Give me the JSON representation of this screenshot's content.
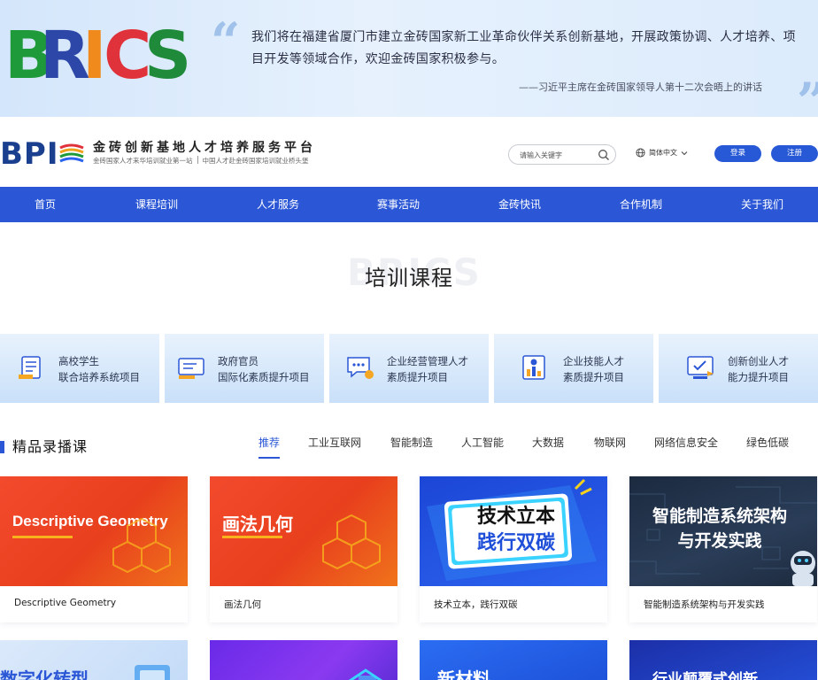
{
  "banner": {
    "logo_letters": [
      "B",
      "R",
      "I",
      "C",
      "S"
    ],
    "quote": "我们将在福建省厦门市建立金砖国家新工业革命伙伴关系创新基地，开展政策协调、人才培养、项目开发等领域合作，欢迎金砖国家积极参与。",
    "source": "——习近平主席在金砖国家领导人第十二次会晤上的讲话"
  },
  "header": {
    "logo_text": "BPI",
    "site_title": "金砖创新基地人才培养服务平台",
    "site_sub_left": "金砖国家人才来华培训就业第一站",
    "site_sub_right": "中国人才赴金砖国家培训就业桥头堡",
    "search_placeholder": "请输入关键字",
    "language": "简体中文",
    "login": "登录",
    "register": "注册"
  },
  "nav": {
    "items": [
      "首页",
      "课程培训",
      "人才服务",
      "赛事活动",
      "金砖快讯",
      "合作机制",
      "关于我们"
    ]
  },
  "training": {
    "watermark": "BRICS",
    "title": "培训课程",
    "categories": [
      {
        "line1": "高校学生",
        "line2": "联合培养系统项目",
        "icon": "student-icon"
      },
      {
        "line1": "政府官员",
        "line2": "国际化素质提升项目",
        "icon": "official-icon"
      },
      {
        "line1": "企业经营管理人才",
        "line2": "素质提升项目",
        "icon": "manager-icon"
      },
      {
        "line1": "企业技能人才",
        "line2": "素质提升项目",
        "icon": "skills-icon"
      },
      {
        "line1": "创新创业人才",
        "line2": "能力提升项目",
        "icon": "innovation-icon"
      }
    ]
  },
  "courses": {
    "title": "精品录播课",
    "tabs": [
      "推荐",
      "工业互联网",
      "智能制造",
      "人工智能",
      "大数据",
      "物联网",
      "网络信息安全",
      "绿色低碳"
    ],
    "active_tab": "推荐",
    "items": [
      {
        "thumb_text": "Descriptive Geometry",
        "label": "Descriptive Geometry"
      },
      {
        "thumb_text": "画法几何",
        "label": "画法几何"
      },
      {
        "thumb_line1": "技术立本",
        "thumb_line2": "践行双碳",
        "label": "技术立本，践行双碳"
      },
      {
        "thumb_line1": "智能制造系统架构",
        "thumb_line2": "与开发实践",
        "label": "智能制造系统架构与开发实践"
      }
    ],
    "row2": [
      {
        "thumb_text": "数字化转型"
      },
      {
        "thumb_text": ""
      },
      {
        "thumb_text": "新材料"
      },
      {
        "thumb_text": "行业颠覆式创新"
      }
    ]
  },
  "colors": {
    "primary": "#2b57d6",
    "banner_bg": "#dcebfc",
    "course_red": "#ee4620",
    "accent_yellow": "#f7b21d"
  }
}
